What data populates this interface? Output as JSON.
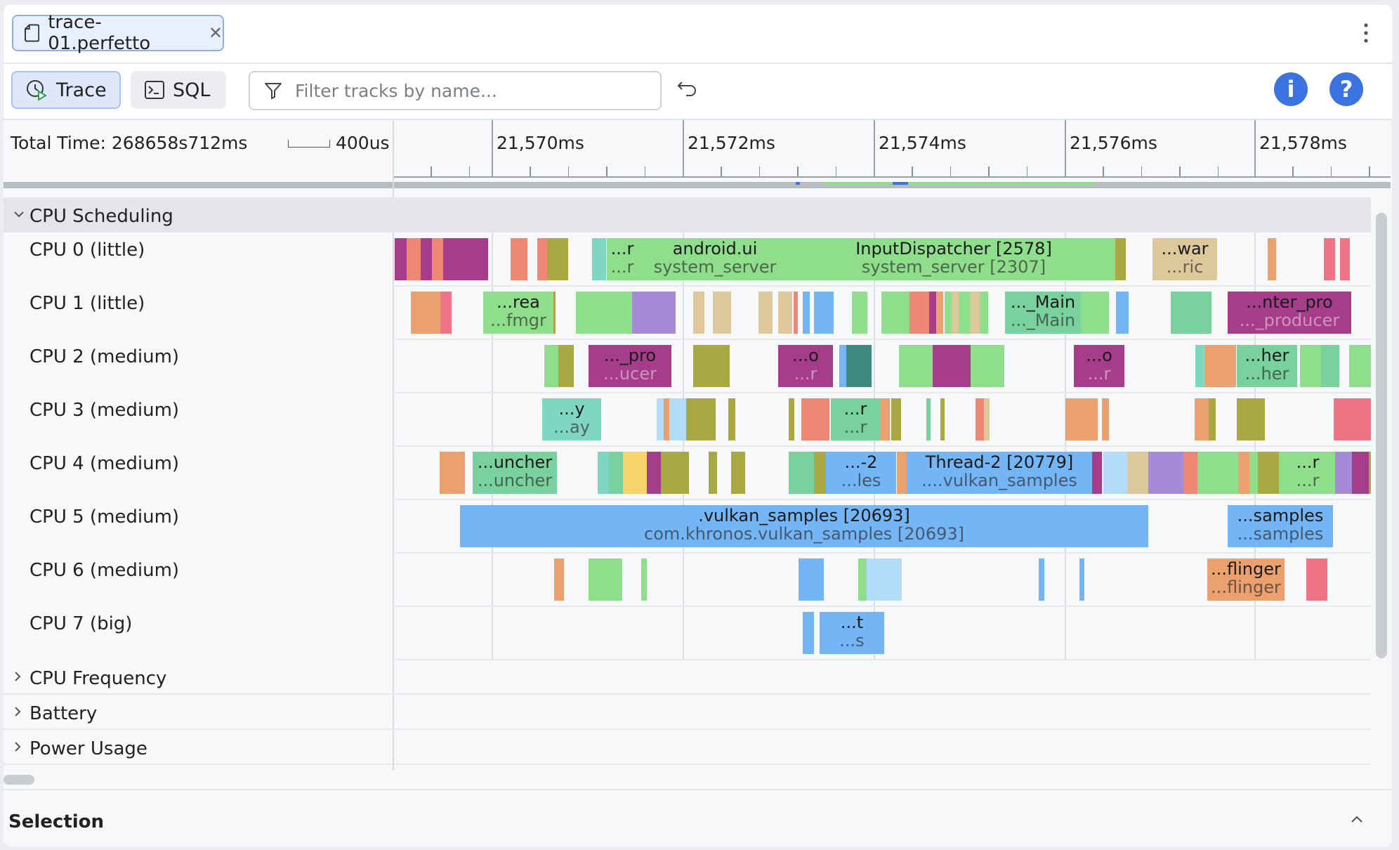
{
  "tab": {
    "title": "trace-01.perfetto"
  },
  "toolbar": {
    "trace_label": "Trace",
    "sql_label": "SQL",
    "filter_placeholder": "Filter tracks by name..."
  },
  "ruler": {
    "total_time": "Total Time: 268658s712ms",
    "scale_label": "400us",
    "ticks": [
      "21,570ms",
      "21,572ms",
      "21,574ms",
      "21,576ms",
      "21,578ms"
    ]
  },
  "group": {
    "title": "CPU Scheduling"
  },
  "tracks": [
    "CPU 0 (little)",
    "CPU 1 (little)",
    "CPU 2 (medium)",
    "CPU 3 (medium)",
    "CPU 4 (medium)",
    "CPU 5 (medium)",
    "CPU 6 (medium)",
    "CPU 7 (big)"
  ],
  "collapsed_groups": [
    "CPU Frequency",
    "Battery",
    "Power Usage"
  ],
  "selection": {
    "title": "Selection"
  },
  "colors": {
    "green": "#8ede8c",
    "olive": "#a9a843",
    "magenta": "#a63d8a",
    "salmon": "#ee8875",
    "orange": "#eaa06f",
    "teal": "#7fd7c2",
    "blue": "#74b5f5",
    "lightblue": "#b3dcfa",
    "purple": "#a58ad8",
    "tan": "#ddc89c",
    "pink": "#ef7486",
    "darkteal": "#3f8a7e",
    "yellow": "#f7d36b",
    "mint": "#79d19e"
  },
  "slices": [
    {
      "row": 0,
      "l1": "...r",
      "l2": "...r",
      "c": "green"
    },
    {
      "row": 0,
      "l1": "android.ui",
      "l2": "system_server",
      "c": "green"
    },
    {
      "row": 0,
      "l1": "InputDispatcher [2578]",
      "l2": "system_server [2307]",
      "c": "green"
    },
    {
      "row": 0,
      "l1": "...war",
      "l2": "...ric",
      "c": "tan"
    },
    {
      "row": 1,
      "l1": "...rea",
      "l2": "...fmgr",
      "c": "green"
    },
    {
      "row": 1,
      "l1": "..._Main",
      "l2": "..._Main",
      "c": "mint"
    },
    {
      "row": 1,
      "l1": "...nter_pro",
      "l2": "..._producer",
      "c": "magenta"
    },
    {
      "row": 2,
      "l1": "..._pro",
      "l2": "...ucer",
      "c": "magenta"
    },
    {
      "row": 2,
      "l1": "...o",
      "l2": "...r",
      "c": "magenta"
    },
    {
      "row": 2,
      "l1": "...o",
      "l2": "...r",
      "c": "magenta"
    },
    {
      "row": 2,
      "l1": "...her",
      "l2": "...her",
      "c": "mint"
    },
    {
      "row": 3,
      "l1": "...y",
      "l2": "...ay",
      "c": "teal"
    },
    {
      "row": 3,
      "l1": "...r",
      "l2": "...r",
      "c": "mint"
    },
    {
      "row": 4,
      "l1": "...uncher",
      "l2": "...uncher",
      "c": "mint"
    },
    {
      "row": 4,
      "l1": "...-2",
      "l2": "...les",
      "c": "blue"
    },
    {
      "row": 4,
      "l1": "Thread-2 [20779]",
      "l2": "....vulkan_samples",
      "c": "blue"
    },
    {
      "row": 4,
      "l1": "...r",
      "l2": "...r",
      "c": "green"
    },
    {
      "row": 5,
      "l1": ".vulkan_samples [20693]",
      "l2": "com.khronos.vulkan_samples [20693]",
      "c": "blue"
    },
    {
      "row": 5,
      "l1": "...samples",
      "l2": "...samples",
      "c": "blue"
    },
    {
      "row": 6,
      "l1": "...flinger",
      "l2": "...flinger",
      "c": "orange"
    },
    {
      "row": 7,
      "l1": "...t",
      "l2": "...s",
      "c": "blue"
    }
  ]
}
